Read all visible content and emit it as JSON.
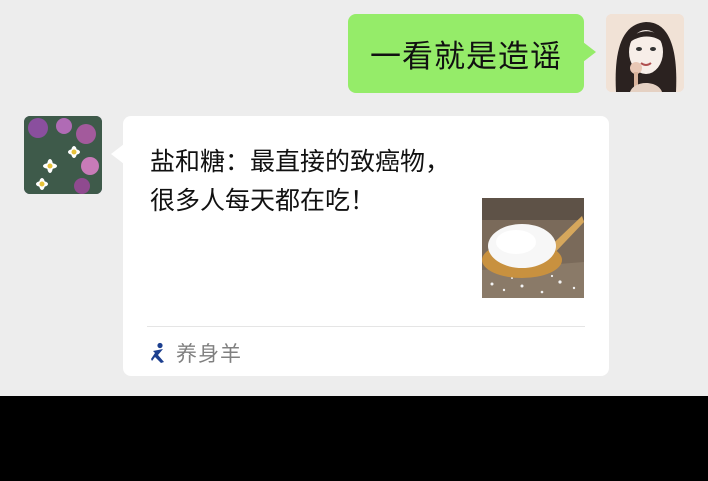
{
  "messages": {
    "outgoing": {
      "text": "一看就是造谣"
    },
    "incoming_card": {
      "title_line1": "盐和糖：最直接的致癌物，",
      "title_line2": "很多人每天都在吃！",
      "source_name": "养身羊",
      "thumbnail": "salt-spoon-image"
    }
  },
  "avatars": {
    "self": "woman-portrait-avatar",
    "other": "flowers-avatar"
  },
  "colors": {
    "chat_background": "#ededed",
    "outgoing_bubble": "#95ec69",
    "card_background": "#ffffff",
    "source_text": "#808080",
    "source_logo": "#1c3f8f"
  }
}
